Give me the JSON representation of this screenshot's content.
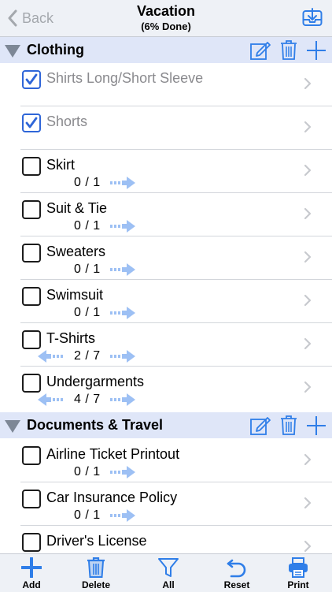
{
  "nav": {
    "back_label": "Back",
    "title": "Vacation",
    "subtitle": "(6% Done)"
  },
  "sections": [
    {
      "title": "Clothing",
      "items": [
        {
          "label": "Shirts Long/Short Sleeve",
          "checked": true,
          "count": ""
        },
        {
          "label": "Shorts",
          "checked": true,
          "count": ""
        },
        {
          "label": "Skirt",
          "checked": false,
          "count": "0 / 1"
        },
        {
          "label": "Suit & Tie",
          "checked": false,
          "count": "0 / 1"
        },
        {
          "label": "Sweaters",
          "checked": false,
          "count": "0 / 1"
        },
        {
          "label": "Swimsuit",
          "checked": false,
          "count": "0 / 1"
        },
        {
          "label": "T-Shirts",
          "checked": false,
          "count": "2 / 7"
        },
        {
          "label": "Undergarments",
          "checked": false,
          "count": "4 / 7"
        }
      ]
    },
    {
      "title": "Documents & Travel",
      "items": [
        {
          "label": "Airline Ticket Printout",
          "checked": false,
          "count": "0 / 1"
        },
        {
          "label": "Car Insurance Policy",
          "checked": false,
          "count": "0 / 1"
        },
        {
          "label": "Driver's License",
          "checked": false,
          "count": ""
        }
      ]
    }
  ],
  "toolbar": {
    "add": "Add",
    "delete": "Delete",
    "all": "All",
    "reset": "Reset",
    "print": "Print"
  },
  "colors": {
    "accent": "#2f7ee8",
    "section_bg": "#dfe6f8",
    "bar_bg": "#eef1f6"
  }
}
